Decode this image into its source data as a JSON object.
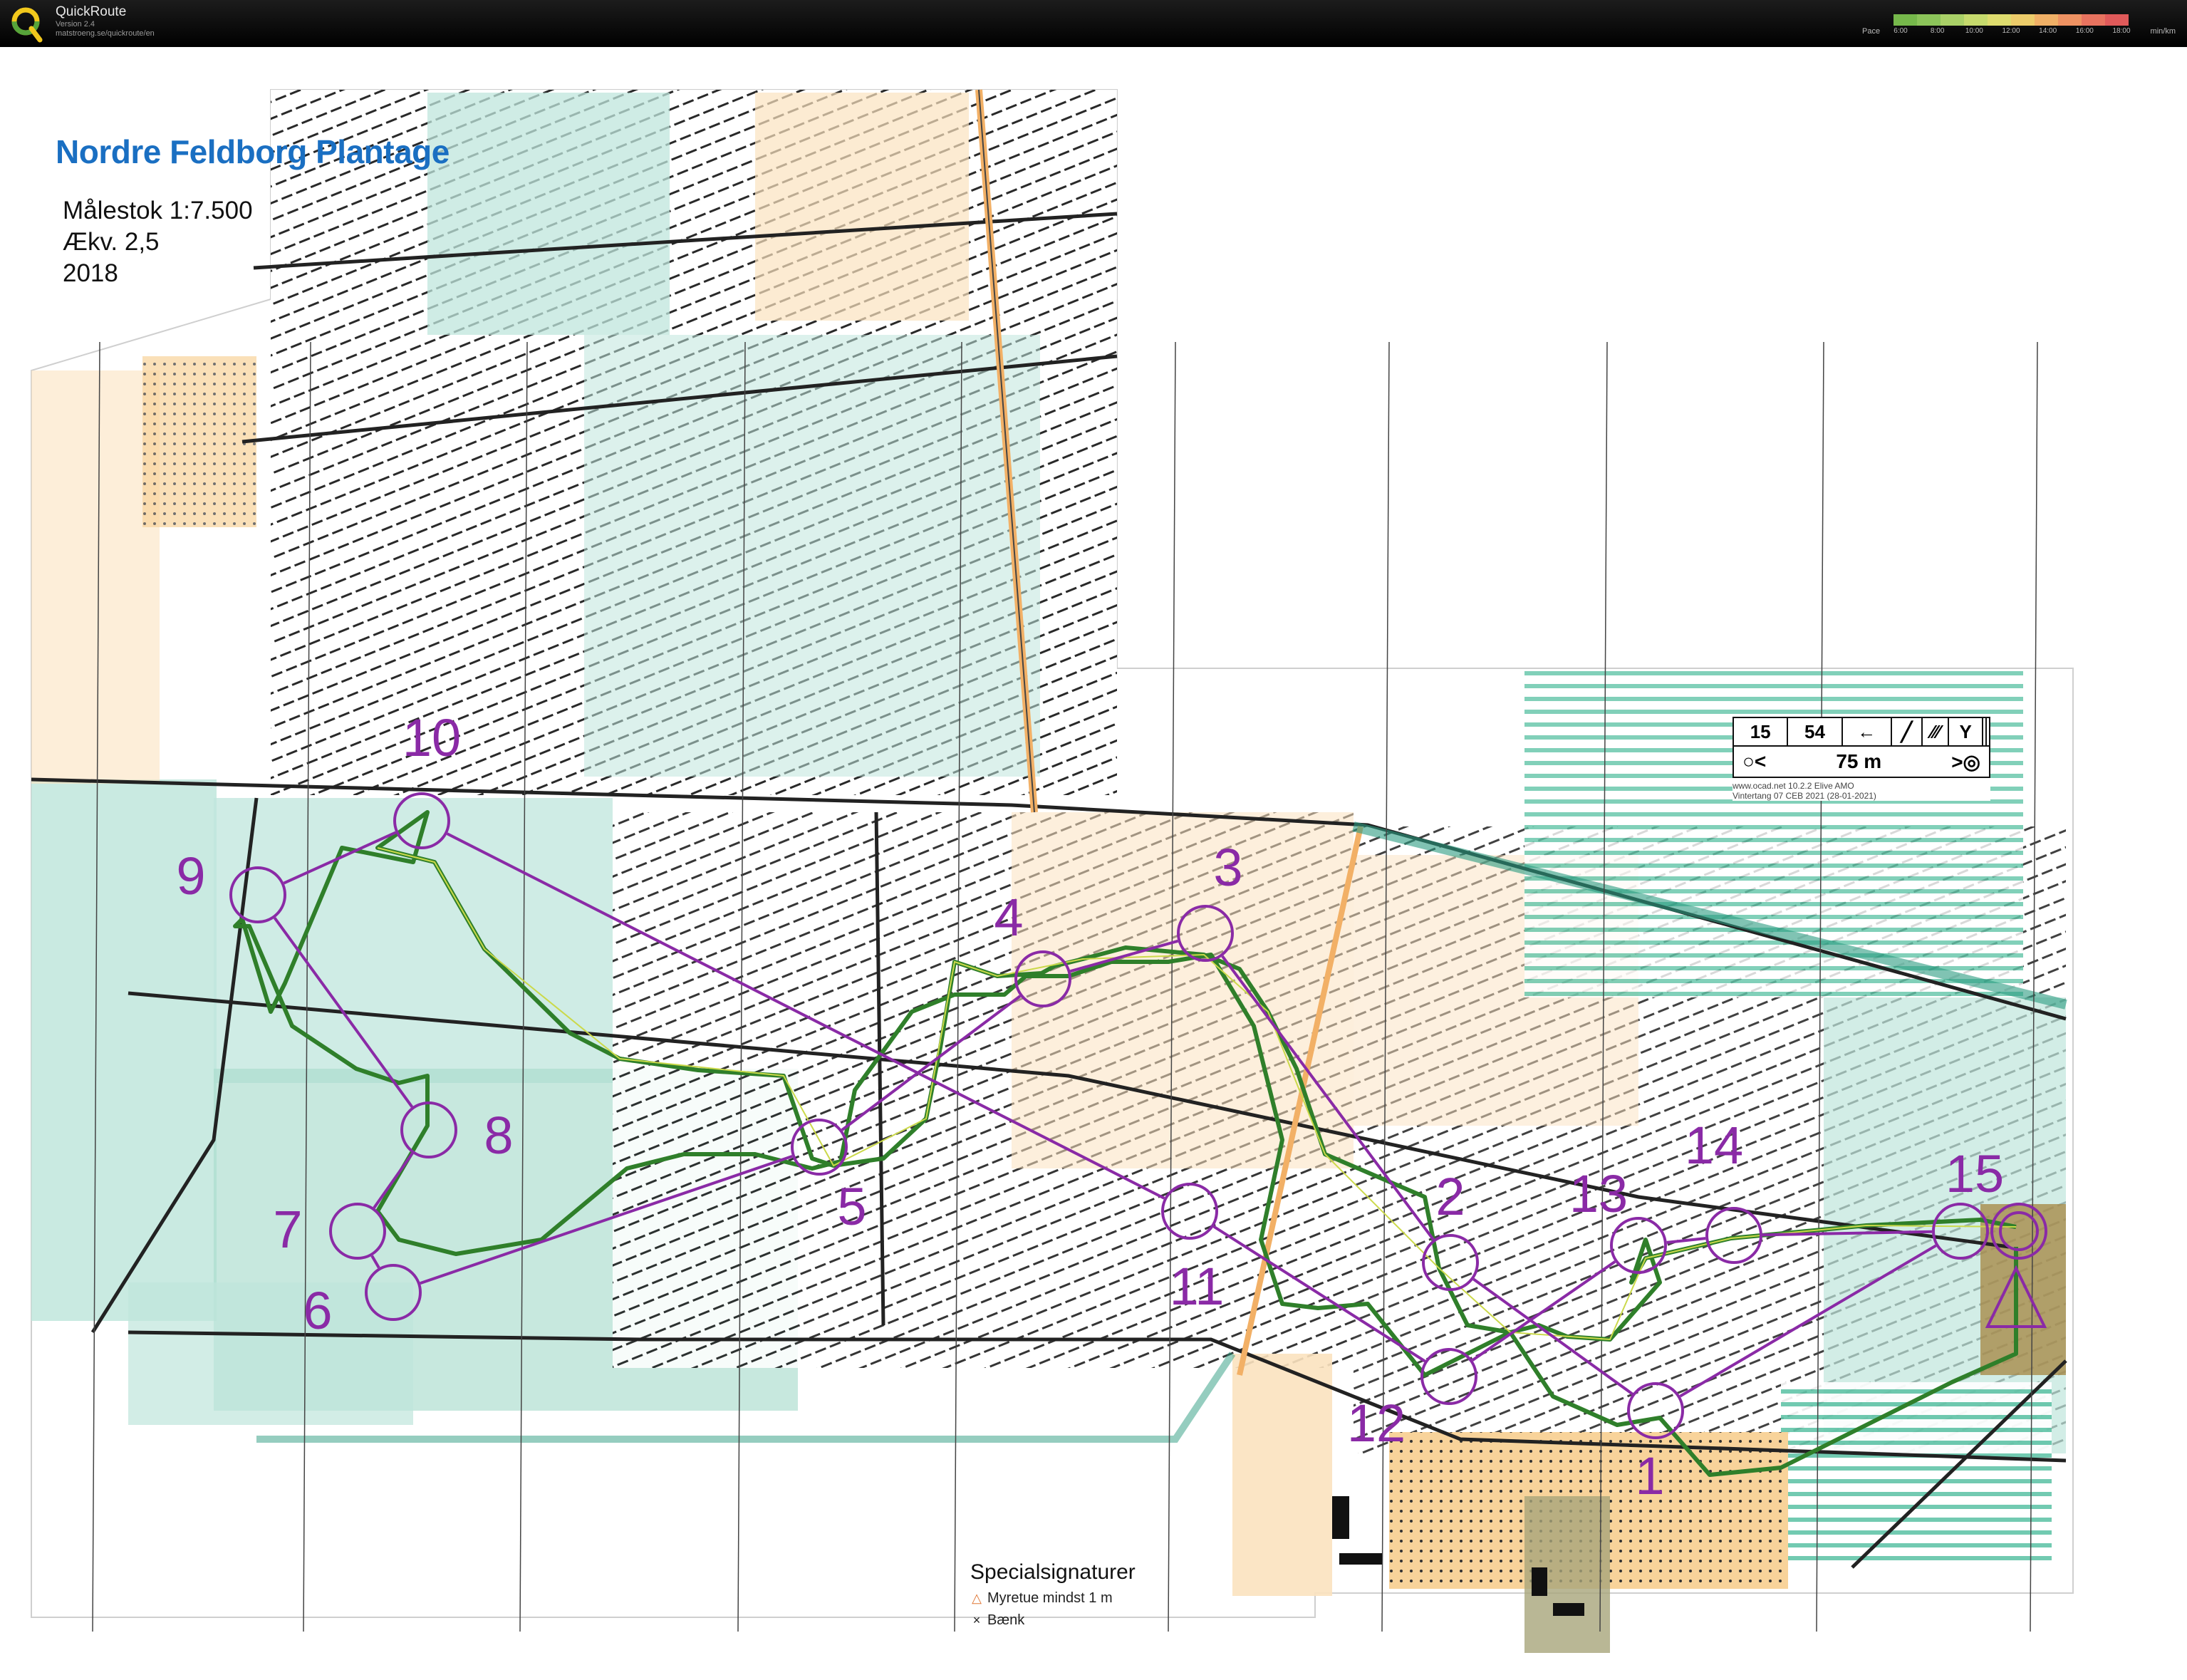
{
  "app": {
    "name": "QuickRoute",
    "version": "Version 2.4",
    "url": "matstroeng.se/quickroute/en"
  },
  "pace_scale": {
    "label": "Pace",
    "unit": "min/km",
    "ticks": [
      "6:00",
      "8:00",
      "10:00",
      "12:00",
      "14:00",
      "16:00",
      "18:00"
    ],
    "colors": [
      "#76b84b",
      "#8cc45a",
      "#a9d067",
      "#c6da6d",
      "#dedc6e",
      "#eccc6a",
      "#f0b066",
      "#ee9262",
      "#e8735f",
      "#e05a5a"
    ]
  },
  "map": {
    "title": "Nordre Feldborg Plantage",
    "scale": "Målestok 1:7.500",
    "equidistance": "Ækv. 2,5",
    "year": "2018",
    "colors": {
      "course": "#8a2aa6",
      "route": "#2f7f2a",
      "forest": "#bfe6dc",
      "open": "#fbe2bf",
      "road": "#f2b066"
    }
  },
  "controls": [
    {
      "label": "1"
    },
    {
      "label": "2"
    },
    {
      "label": "3"
    },
    {
      "label": "4"
    },
    {
      "label": "5"
    },
    {
      "label": "6"
    },
    {
      "label": "7"
    },
    {
      "label": "8"
    },
    {
      "label": "9"
    },
    {
      "label": "10"
    },
    {
      "label": "11"
    },
    {
      "label": "12"
    },
    {
      "label": "13"
    },
    {
      "label": "14"
    },
    {
      "label": "15"
    }
  ],
  "legend": {
    "title": "Specialsignaturer",
    "items": [
      {
        "symbol": "triangle-icon",
        "text": "Myretue mindst 1 m"
      },
      {
        "symbol": "cross-icon",
        "text": "Bænk"
      }
    ]
  },
  "description_sheet": {
    "row": [
      "15",
      "54",
      "←",
      "╱",
      "⁄⁄⁄",
      "Y",
      "",
      ""
    ],
    "distance": "75 m",
    "footer_lines": [
      "www.ocad.net 10.2.2 Elive AMO",
      "Vintertang 07 CEB 2021 (28-01-2021)"
    ]
  }
}
